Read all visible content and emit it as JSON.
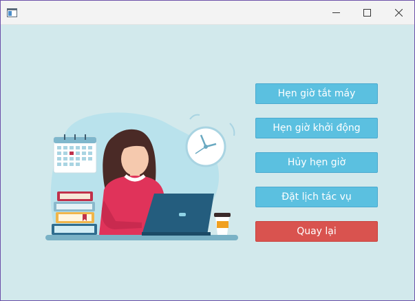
{
  "window": {
    "controls": {
      "minimize_icon": "minimize-icon",
      "maximize_icon": "maximize-icon",
      "close_icon": "close-icon"
    }
  },
  "actions": {
    "schedule_shutdown": "Hẹn giờ tắt máy",
    "schedule_startup": "Hẹn giờ khởi động",
    "cancel_schedule": "Hủy hẹn giờ",
    "schedule_task": "Đặt lịch tác vụ",
    "back": "Quay lại"
  },
  "colors": {
    "background": "#d2e9ec",
    "primary_button": "#5bc0e0",
    "danger_button": "#d9534f"
  }
}
